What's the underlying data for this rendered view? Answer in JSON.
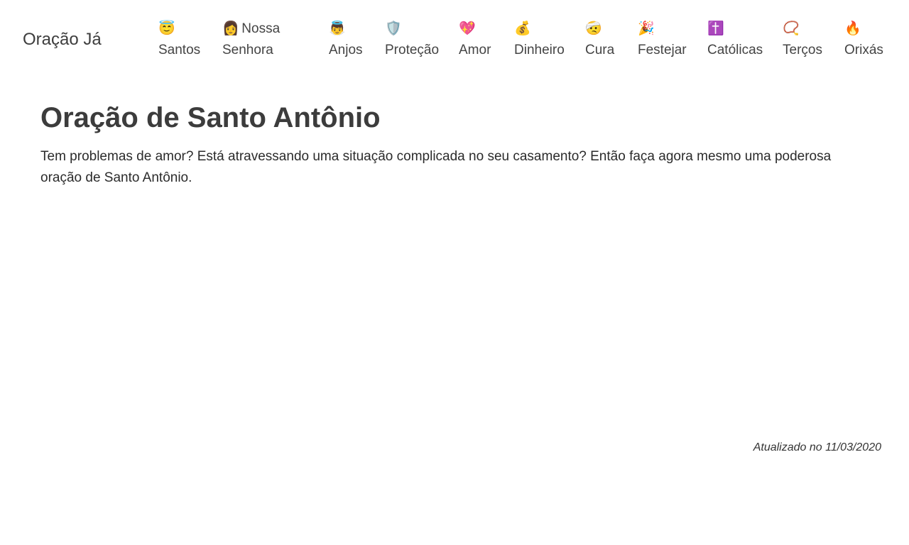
{
  "header": {
    "brand": "Oração Já",
    "nav": [
      {
        "icon": "😇",
        "icon_name": "smiling-face-with-halo-icon",
        "label": "Santos"
      },
      {
        "icon": "👩",
        "icon_name": "woman-icon",
        "label": "Nossa",
        "label2": "Senhora"
      },
      {
        "icon": "👼",
        "icon_name": "baby-angel-icon",
        "label": "Anjos"
      },
      {
        "icon": "🛡️",
        "icon_name": "shield-icon",
        "label": "Proteção"
      },
      {
        "icon": "💖",
        "icon_name": "sparkling-heart-icon",
        "label": "Amor"
      },
      {
        "icon": "💰",
        "icon_name": "money-bag-icon",
        "label": "Dinheiro"
      },
      {
        "icon": "🤕",
        "icon_name": "face-with-head-bandage-icon",
        "label": "Cura"
      },
      {
        "icon": "🎉",
        "icon_name": "party-popper-icon",
        "label": "Festejar"
      },
      {
        "icon": "✝️",
        "icon_name": "latin-cross-icon",
        "label": "Católicas"
      },
      {
        "icon": "📿",
        "icon_name": "prayer-beads-icon",
        "label": "Terços"
      },
      {
        "icon": "🔥",
        "icon_name": "fire-icon",
        "label": "Orixás"
      }
    ]
  },
  "main": {
    "title": "Oração de Santo Antônio",
    "intro": "Tem problemas de amor? Está atravessando uma situação complicada no seu casamento? Então faça agora mesmo uma poderosa oração de Santo Antônio."
  },
  "footer": {
    "updated": "Atualizado no 11/03/2020"
  }
}
